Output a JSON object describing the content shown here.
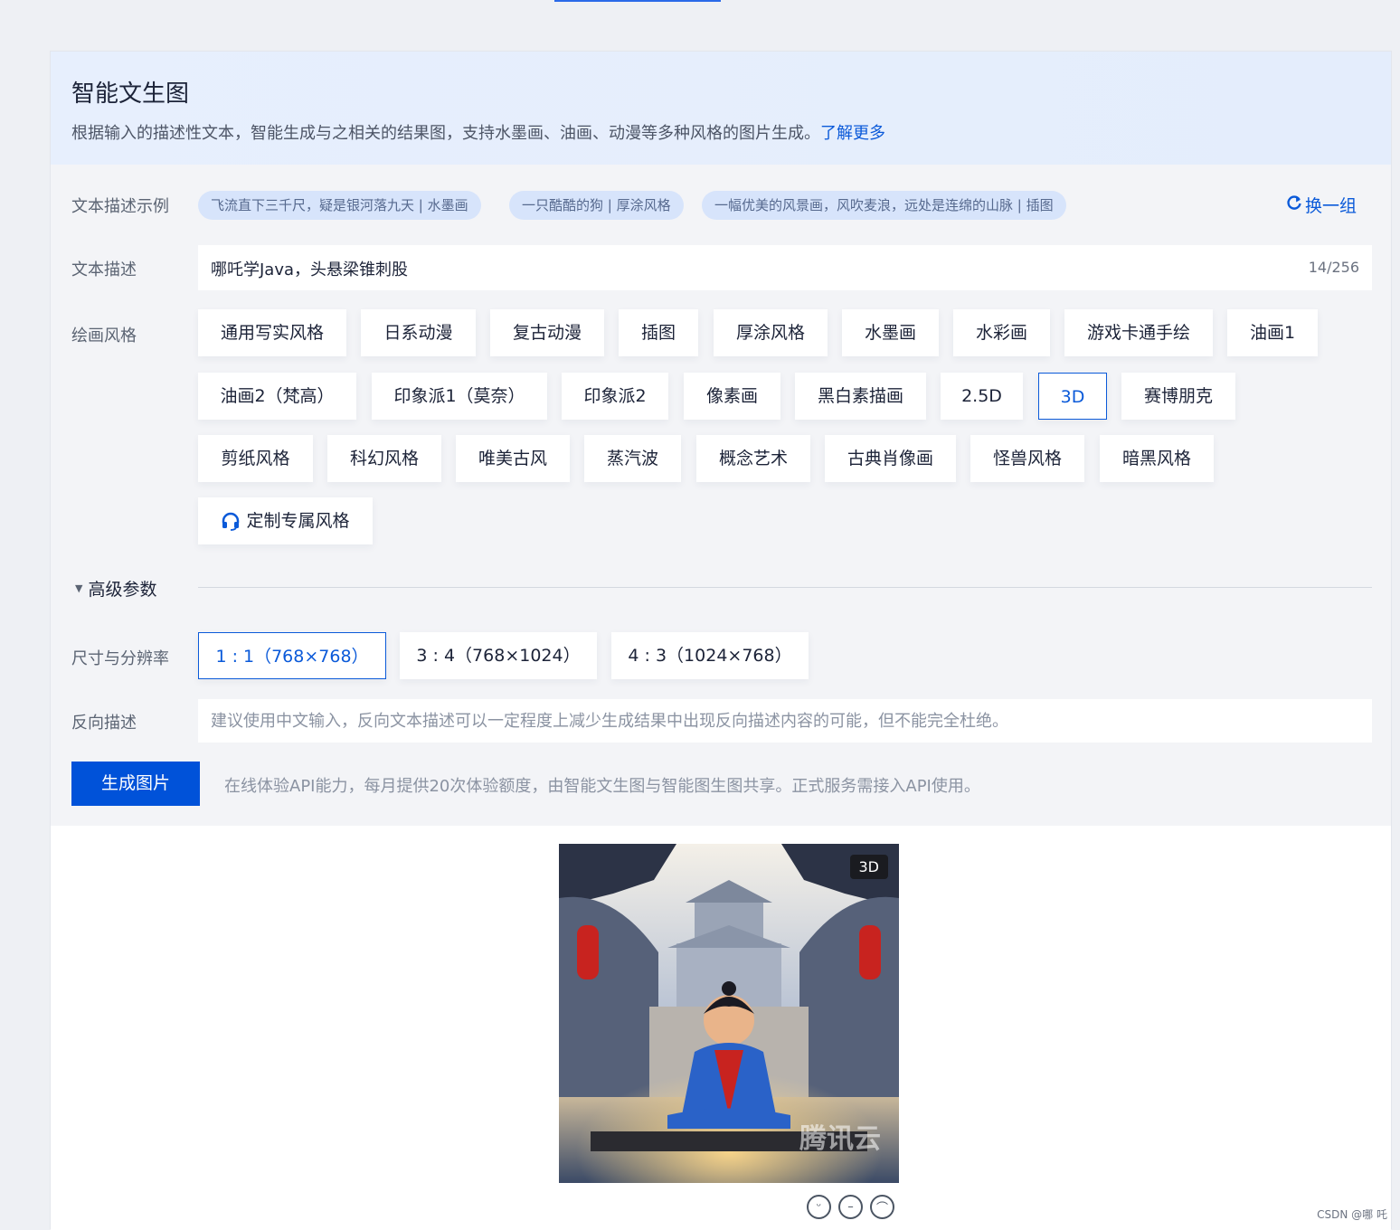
{
  "header": {
    "title": "智能文生图",
    "description": "根据输入的描述性文本，智能生成与之相关的结果图，支持水墨画、油画、动漫等多种风格的图片生成。",
    "learn_more": "了解更多"
  },
  "examples": {
    "label": "文本描述示例",
    "tags": [
      "飞流直下三千尺，疑是银河落九天 | 水墨画",
      "一只酷酷的狗 | 厚涂风格",
      "一幅优美的风景画，风吹麦浪，远处是连绵的山脉 | 插图"
    ],
    "refresh": "换一组"
  },
  "prompt": {
    "label": "文本描述",
    "value": "哪吒学Java，头悬梁锥刺股",
    "counter": "14/256"
  },
  "styles": {
    "label": "绘画风格",
    "items": [
      "通用写实风格",
      "日系动漫",
      "复古动漫",
      "插图",
      "厚涂风格",
      "水墨画",
      "水彩画",
      "游戏卡通手绘",
      "油画1",
      "油画2（梵高）",
      "印象派1（莫奈）",
      "印象派2",
      "像素画",
      "黑白素描画",
      "2.5D",
      "3D",
      "赛博朋克",
      "剪纸风格",
      "科幻风格",
      "唯美古风",
      "蒸汽波",
      "概念艺术",
      "古典肖像画",
      "怪兽风格",
      "暗黑风格"
    ],
    "selected": "3D",
    "custom": "定制专属风格"
  },
  "advanced": {
    "label": "高级参数"
  },
  "size": {
    "label": "尺寸与分辨率",
    "options": [
      "1 : 1（768×768）",
      "3 : 4（768×1024）",
      "4 : 3（1024×768）"
    ],
    "selected": "1 : 1（768×768）"
  },
  "negative": {
    "label": "反向描述",
    "placeholder": "建议使用中文输入，反向文本描述可以一定程度上减少生成结果中出现反向描述内容的可能，但不能完全杜绝。"
  },
  "generate": {
    "button": "生成图片",
    "note": "在线体验API能力，每月提供20次体验额度，由智能文生图与智能图生图共享。正式服务需接入API使用。"
  },
  "result": {
    "badge": "3D",
    "watermark": "腾讯云"
  },
  "footer": {
    "credit": "CSDN @哪 吒"
  },
  "colors": {
    "accent": "#0052d9",
    "link": "#0b5ad9"
  }
}
